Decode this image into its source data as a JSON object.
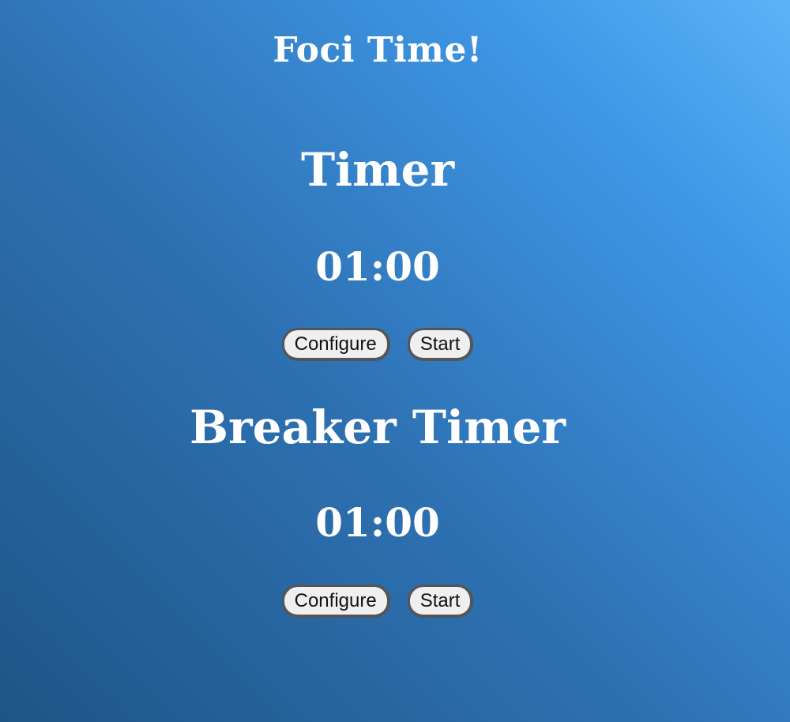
{
  "app": {
    "title": "Foci Time!"
  },
  "timers": [
    {
      "title": "Timer",
      "time": "01:00",
      "configure_label": "Configure",
      "start_label": "Start"
    },
    {
      "title": "Breaker Timer",
      "time": "01:00",
      "configure_label": "Configure",
      "start_label": "Start"
    }
  ],
  "colors": {
    "text": "#ffffff",
    "button_bg": "#efefef",
    "button_border": "#555555",
    "gradient_dark": "#1f5586",
    "gradient_light": "#5cb3f7"
  }
}
